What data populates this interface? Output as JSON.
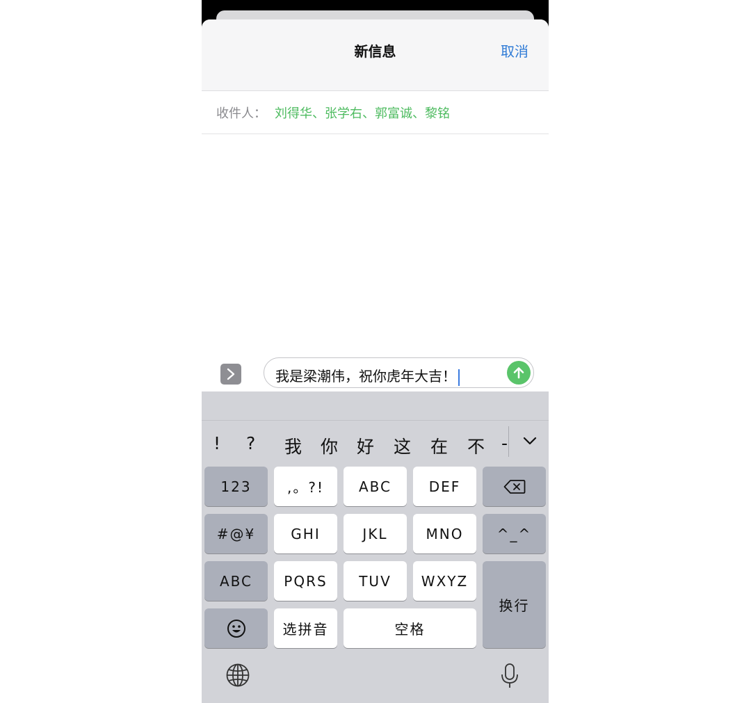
{
  "header": {
    "title": "新信息",
    "cancel_label": "取消"
  },
  "recipients": {
    "label": "收件人：",
    "names": "刘得华、张学右、郭富诚、黎铭"
  },
  "composer": {
    "message": "我是梁潮伟，祝你虎年大吉！",
    "apps_icon": "chevron-right-icon",
    "send_icon": "arrow-up-icon"
  },
  "candidates": [
    "!",
    "?",
    "我",
    "你",
    "好",
    "这",
    "在",
    "不",
    "-"
  ],
  "keys": {
    "numbers": "123",
    "punct": ",。?!",
    "abc": "ABC",
    "def": "DEF",
    "symbols": "#@¥",
    "ghi": "GHI",
    "jkl": "JKL",
    "mno": "MNO",
    "emoticon": "^_^",
    "abc_mode": "ABC",
    "pqrs": "PQRS",
    "tuv": "TUV",
    "wxyz": "WXYZ",
    "return": "换行",
    "pinyin": "选拼音",
    "space": "空格"
  },
  "icons": {
    "delete": "delete-icon",
    "emoji": "emoji-icon",
    "globe": "globe-icon",
    "mic": "microphone-icon",
    "collapse": "chevron-down-icon"
  },
  "colors": {
    "accent_blue": "#2f7bd6",
    "recipient_green": "#4dbb5f",
    "send_green": "#5ac46a",
    "keyboard_bg": "#d2d3d8"
  }
}
